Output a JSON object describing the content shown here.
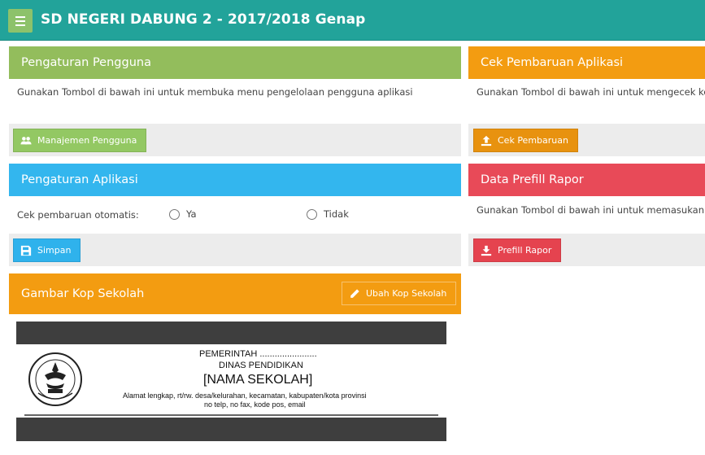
{
  "app": {
    "title": "SD NEGERI DABUNG 2 - 2017/2018 Genap"
  },
  "colors": {
    "topbar": "#22a39a",
    "green": "#93bd5c",
    "orange": "#f39c11",
    "blue": "#33b6ee",
    "red": "#e84a58"
  },
  "pengguna": {
    "title": "Pengaturan Pengguna",
    "description": "Gunakan Tombol di bawah ini untuk membuka menu pengelolaan pengguna aplikasi",
    "button": "Manajemen Pengguna",
    "button_icon": "users-icon"
  },
  "pembaruan": {
    "title": "Cek Pembaruan Aplikasi",
    "description": "Gunakan Tombol di bawah ini untuk mengecek kete",
    "button": "Cek Pembaruan",
    "button_icon": "upload-icon"
  },
  "aplikasi": {
    "title": "Pengaturan Aplikasi",
    "label": "Cek pembaruan otomatis:",
    "option_ya": "Ya",
    "option_tidak": "Tidak",
    "button": "Simpan",
    "button_icon": "save-icon"
  },
  "prefill": {
    "title": "Data Prefill Rapor",
    "description": "Gunakan Tombol di bawah ini untuk memasukan da",
    "button": "Prefill Rapor",
    "button_icon": "download-icon"
  },
  "kop": {
    "title": "Gambar Kop Sekolah",
    "button": "Ubah Kop Sekolah",
    "button_icon": "pencil-icon",
    "line1": "PEMERINTAH .......................",
    "line2": "DINAS PENDIDIKAN",
    "line3": "[NAMA SEKOLAH]",
    "line4": "Alamat lengkap, rt/rw. desa/kelurahan, kecamatan, kabupaten/kota provinsi",
    "line5": "no telp, no fax, kode pos, email",
    "logo_text": "TUT WURI HANDAYANI"
  }
}
